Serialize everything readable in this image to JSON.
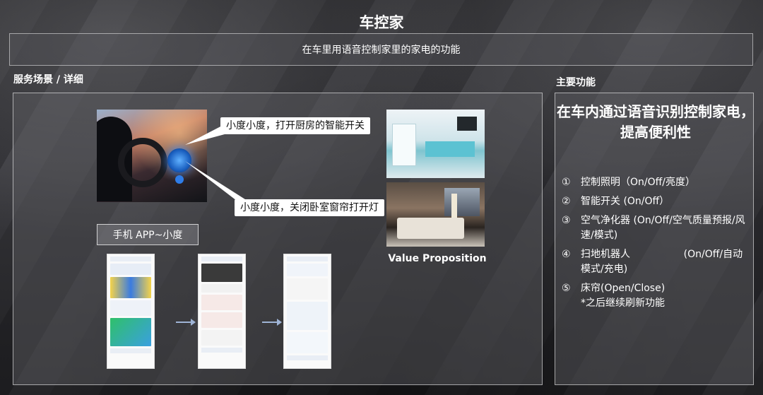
{
  "page": {
    "title": "车控家",
    "subtitle": "在车里用语音控制家里的家电的功能"
  },
  "scenario": {
    "section_label": "服务场景 / 详细",
    "bubble_1": "小度小度，打开厨房的智能开关",
    "bubble_2": "小度小度，关闭卧室窗帘打开灯",
    "app_label": "手机 APP~小度",
    "value_proposition": "Value Proposition"
  },
  "features": {
    "section_label": "主要功能",
    "headline": "在车内通过语音识别控制家电，提高便利性",
    "items": [
      {
        "num": "①",
        "text": "控制照明（On/Off/亮度）"
      },
      {
        "num": "②",
        "text": "智能开关 (On/Off）"
      },
      {
        "num": "③",
        "text": "空气净化器 (On/Off/空气质量预报/风速/模式)"
      },
      {
        "num": "④",
        "text": "扫地机器人                 (On/Off/自动模式/充电)"
      },
      {
        "num": "⑤",
        "text": "床帘(Open/Close)\n*之后继续刷新功能"
      }
    ]
  },
  "colors": {
    "accent_blue": "#2f7de8",
    "panel_border": "#ffffff",
    "bubble_bg": "#ffffff"
  }
}
